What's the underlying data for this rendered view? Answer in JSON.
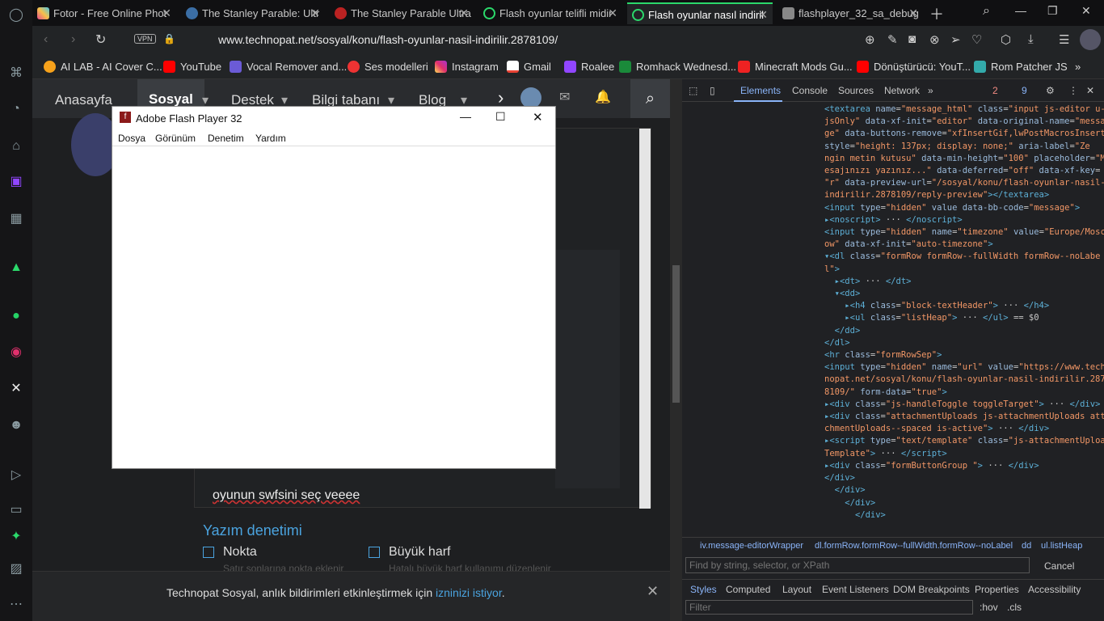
{
  "tabs": [
    {
      "label": "Fotor - Free Online Phot",
      "color": "#e84a8e"
    },
    {
      "label": "The Stanley Parable: Ultr",
      "color": "#3b6ea5"
    },
    {
      "label": "The Stanley Parable Ultra",
      "color": "#b22"
    },
    {
      "label": "Flash oyunlar telifli midir",
      "color": "#2bd96b"
    },
    {
      "label": "Flash oyunlar nasıl indiril",
      "color": "#2bd96b"
    },
    {
      "label": "flashplayer_32_sa_debug",
      "color": "#888"
    }
  ],
  "address": {
    "vpn": "VPN",
    "url": "www.technopat.net/sosyal/konu/flash-oyunlar-nasil-indirilir.2878109/"
  },
  "bookmarks": [
    "AI LAB - AI Cover C...",
    "YouTube",
    "Vocal Remover and...",
    "Ses modelleri",
    "Instagram",
    "Gmail",
    "Roalee",
    "Romhack Wednesd...",
    "Minecraft Mods Gu...",
    "Dönüştürücü: YouT...",
    "Rom Patcher JS"
  ],
  "site": {
    "nav": [
      "Anasayfa",
      "Sosyal",
      "Destek",
      "Bilgi tabanı",
      "Blog"
    ],
    "post_text": "oyunun swfsini seç veeee",
    "spell_title": "Yazım denetimi",
    "opt1": "Nokta",
    "opt2": "Büyük harf",
    "opt1_sub": "Satır sonlarına nokta eklenir",
    "opt2_sub": "Hatalı büyük harf kullanımı düzenlenir",
    "notify_text": "Technopat Sosyal, anlık bildirimleri etkinleştirmek için",
    "notify_link": "izninizi istiyor",
    "notify_end": "."
  },
  "flash": {
    "title": "Adobe Flash Player 32",
    "menu": [
      "Dosya",
      "Görünüm",
      "Denetim",
      "Yardım"
    ]
  },
  "devtools": {
    "tabs": [
      "Elements",
      "Console",
      "Sources",
      "Network"
    ],
    "errors": "2",
    "warnings": "9",
    "breadcrumb": [
      "iv.message-editorWrapper",
      "dl.formRow.formRow--fullWidth.formRow--noLabel",
      "dd",
      "ul.listHeap"
    ],
    "filter_placeholder": "Find by string, selector, or XPath",
    "cancel": "Cancel",
    "subtabs": [
      "Styles",
      "Computed",
      "Layout",
      "Event Listeners",
      "DOM Breakpoints",
      "Properties",
      "Accessibility"
    ],
    "styles_filter": "Filter",
    "hov": ":hov",
    ".cls": ".cls"
  }
}
